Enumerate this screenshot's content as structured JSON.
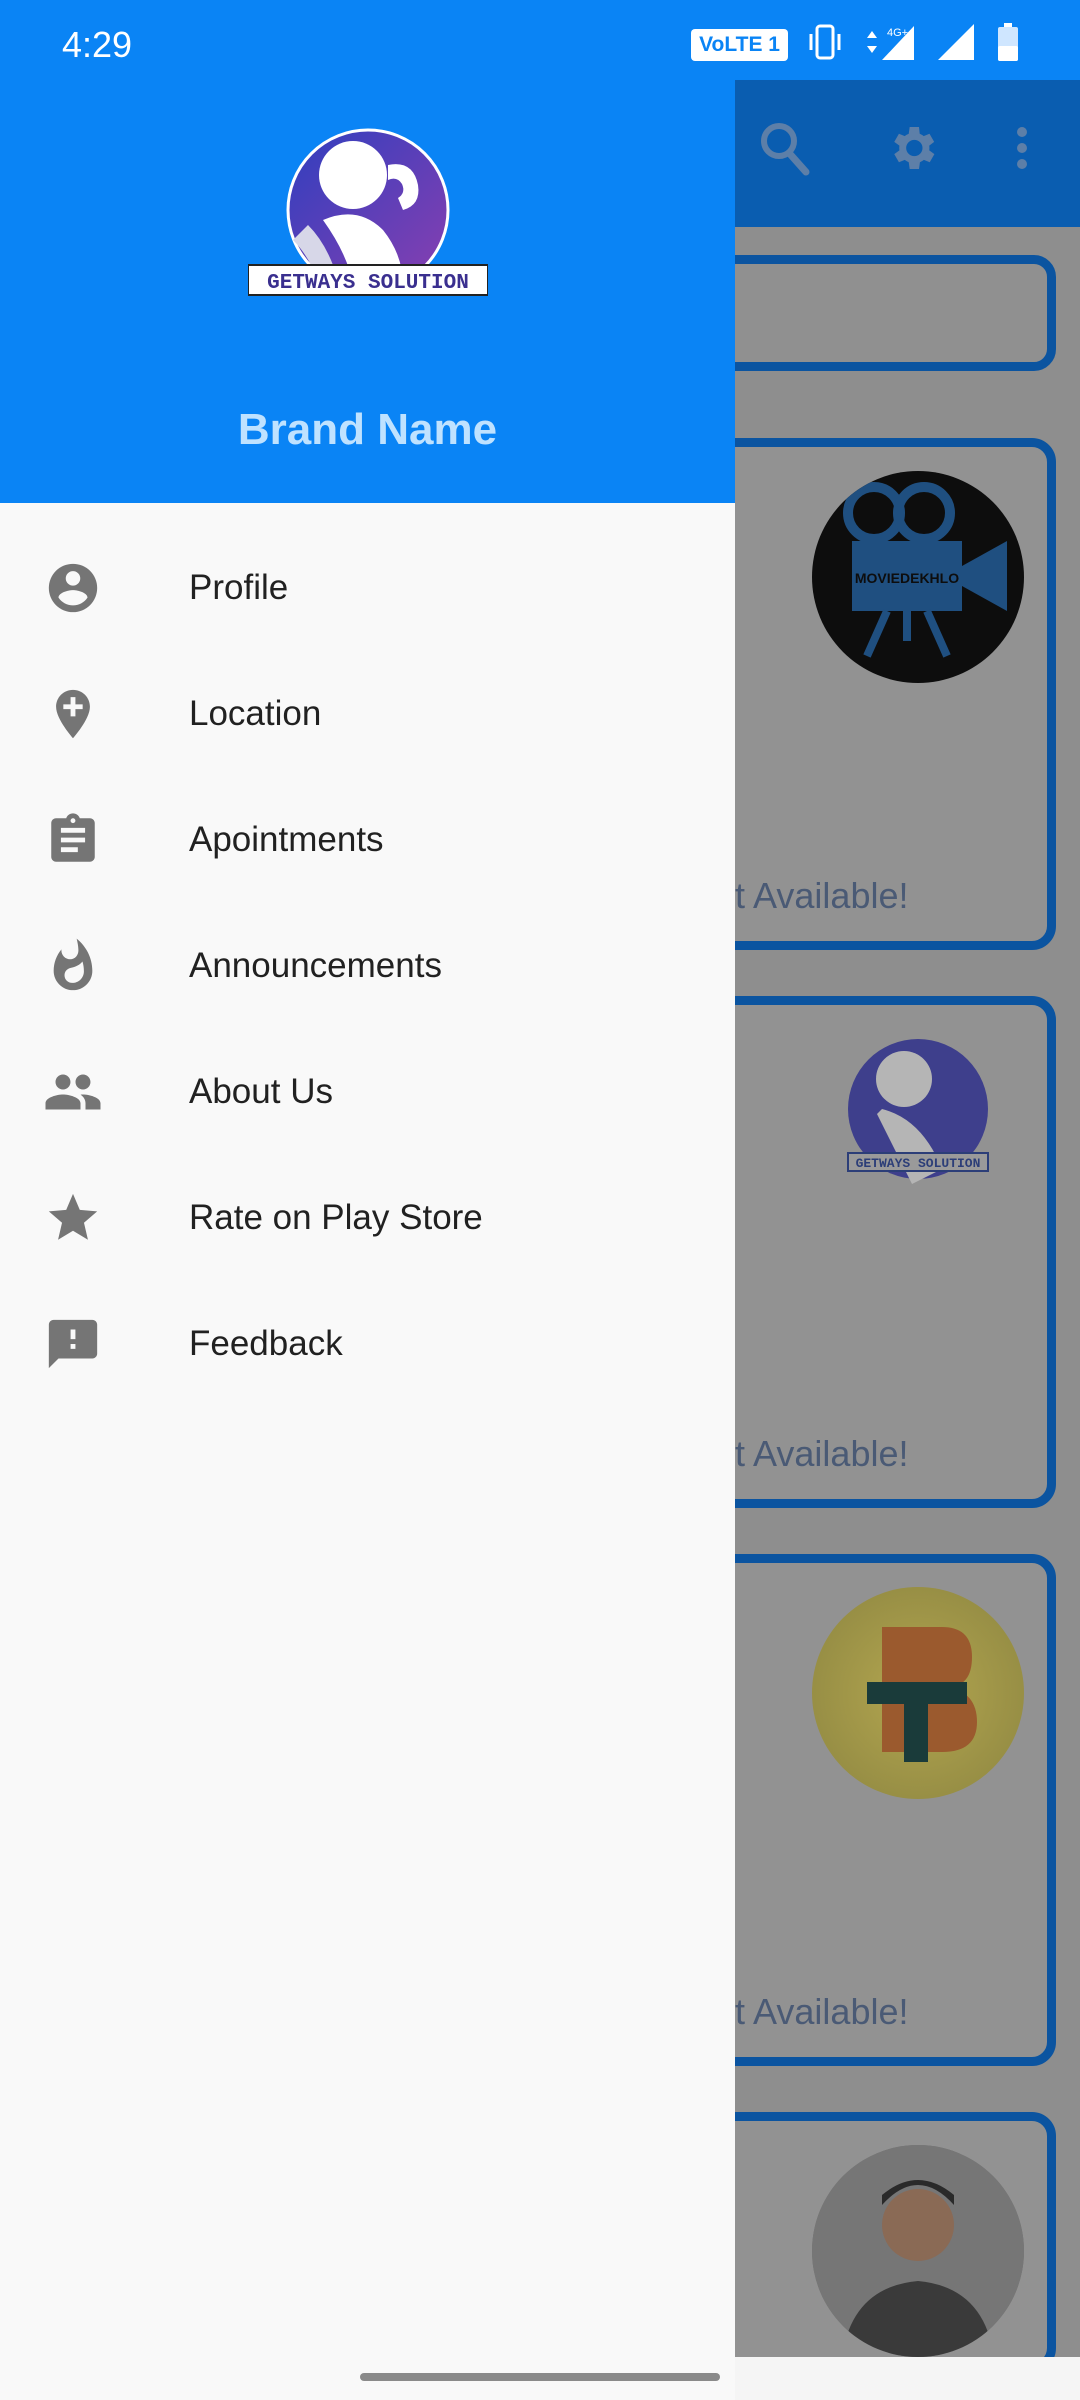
{
  "status_bar": {
    "time": "4:29",
    "volte_label": "VoLTE 1",
    "network_label": "4G+",
    "icons": [
      "vibrate-icon",
      "data-arrows-icon",
      "signal-icon",
      "signal-icon",
      "battery-icon"
    ]
  },
  "drawer": {
    "brand_name": "Brand Name",
    "logo_text": "GETWAYS SOLUTION",
    "items": [
      {
        "label": "Profile",
        "icon": "account-circle-icon"
      },
      {
        "label": "Location",
        "icon": "add-location-icon"
      },
      {
        "label": "Apointments",
        "icon": "clipboard-icon"
      },
      {
        "label": "Announcements",
        "icon": "whatshot-icon"
      },
      {
        "label": "About Us",
        "icon": "people-icon"
      },
      {
        "label": "Rate on Play Store",
        "icon": "star-icon"
      },
      {
        "label": "Feedback",
        "icon": "feedback-icon"
      }
    ]
  },
  "background": {
    "appbar_actions": [
      "search-icon",
      "settings-icon",
      "more-vert-icon"
    ],
    "cards": [
      {
        "status": "Not Available!",
        "avatar_text": "MOVIEDEKHLO"
      },
      {
        "status": "Not Available!",
        "avatar_text": "GETWAYS SOLUTION"
      },
      {
        "status": "Not Available!",
        "avatar_text": ""
      },
      {
        "status": "",
        "avatar_text": ""
      }
    ]
  },
  "colors": {
    "primary": "#0a84f5",
    "dark_primary": "#0b54a0",
    "drawer_bg": "#f9f9f9",
    "brand_text": "#bfe2ff",
    "icon_gray": "#757575"
  }
}
